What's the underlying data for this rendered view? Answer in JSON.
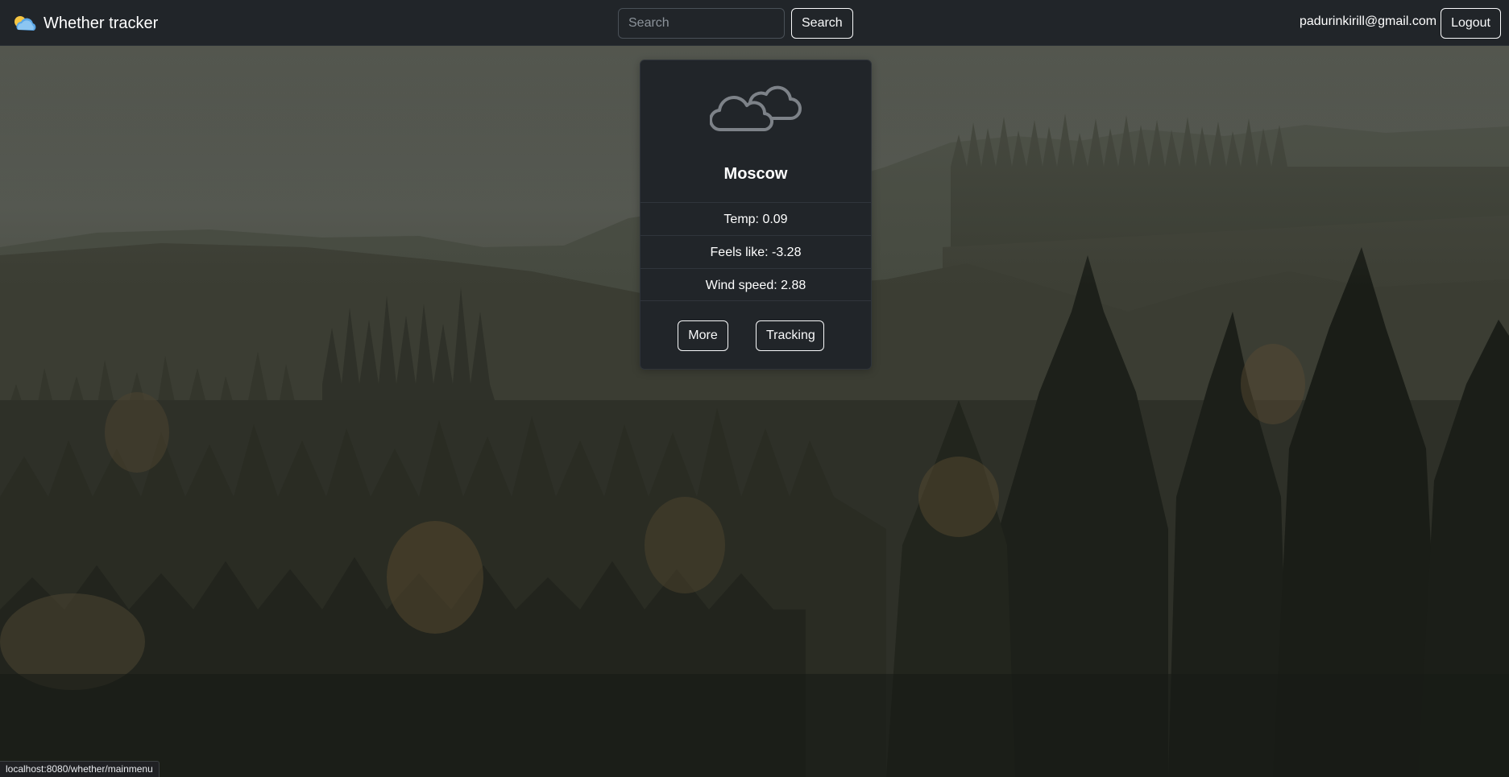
{
  "navbar": {
    "brand_text": "Whether tracker",
    "brand_icon": "sun-behind-cloud-icon",
    "search_placeholder": "Search",
    "search_button": "Search",
    "user_email": "padurinkirill@gmail.com",
    "logout_button": "Logout"
  },
  "card": {
    "weather_icon": "clouds-icon",
    "city": "Moscow",
    "temp": "Temp: 0.09",
    "feels_like": "Feels like: -3.28",
    "wind_speed": "Wind speed: 2.88",
    "more_button": "More",
    "tracking_button": "Tracking"
  },
  "status_bar": {
    "url": "localhost:8080/whether/mainmenu"
  },
  "colors": {
    "navbar_bg": "#212529",
    "card_bg": "#212529",
    "button_border": "#f8f9fa",
    "background_forest": "#2a2c24"
  }
}
